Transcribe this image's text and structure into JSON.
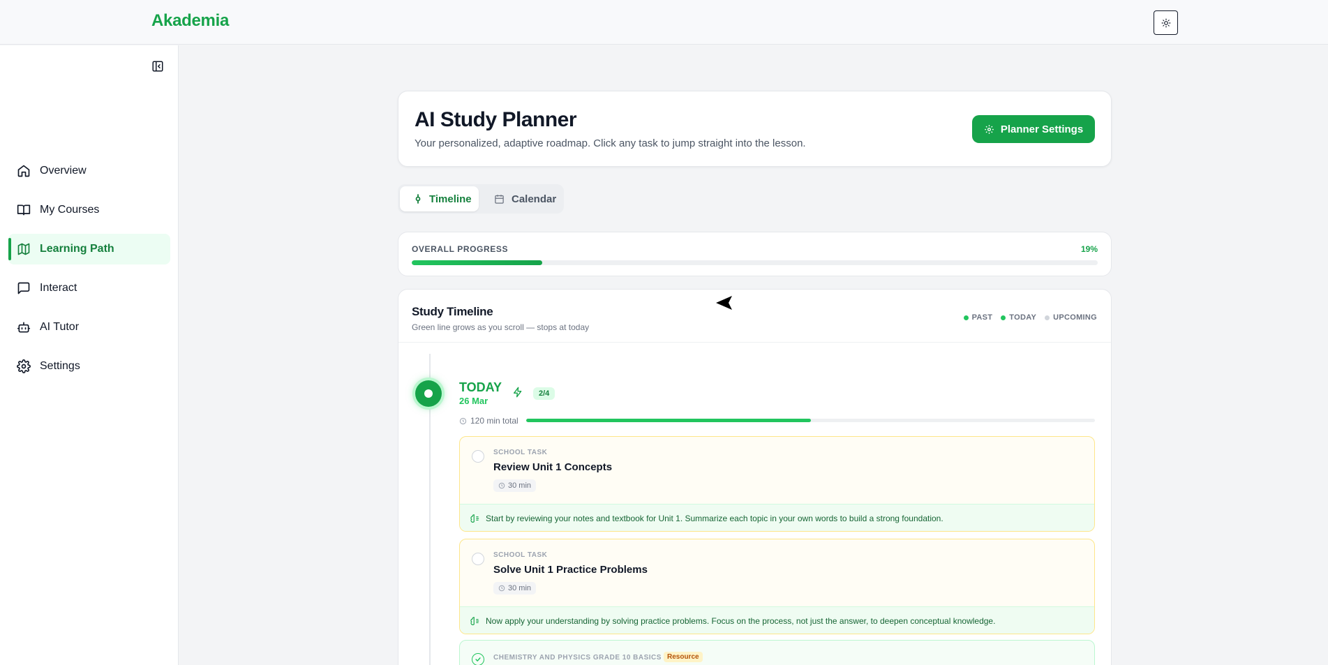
{
  "app": {
    "brand": "Akademia"
  },
  "sidebar": {
    "items": [
      {
        "label": "Overview",
        "icon": "home-icon"
      },
      {
        "label": "My Courses",
        "icon": "book-icon"
      },
      {
        "label": "Learning Path",
        "icon": "map-icon",
        "active": true
      },
      {
        "label": "Interact",
        "icon": "chat-icon"
      },
      {
        "label": "AI Tutor",
        "icon": "bot-icon"
      },
      {
        "label": "Settings",
        "icon": "gear-icon"
      }
    ]
  },
  "header": {
    "title": "AI Study Planner",
    "subtitle": "Your personalized, adaptive roadmap. Click any task to jump straight into the lesson.",
    "settings_button": "Planner Settings"
  },
  "tabs": [
    {
      "label": "Timeline",
      "active": true
    },
    {
      "label": "Calendar",
      "active": false
    }
  ],
  "progress": {
    "label": "OVERALL PROGRESS",
    "percent_text": "19%",
    "value": 0.19
  },
  "timeline": {
    "title": "Study Timeline",
    "subtitle": "Green line grows as you scroll — stops at today",
    "legend": [
      "PAST",
      "TODAY",
      "UPCOMING"
    ],
    "legend_colors": [
      "#22c55e",
      "#22c55e",
      "#d1d5db"
    ],
    "day": {
      "title": "TODAY",
      "date": "26 Mar",
      "count": "2/4",
      "duration": "120 min total",
      "progress": 0.5
    },
    "tasks": [
      {
        "kind": "SCHOOL TASK",
        "name": "Review Unit 1 Concepts",
        "time": "30 min",
        "note": "Start by reviewing your notes and textbook for Unit 1. Summarize each topic in your own words to build a strong foundation."
      },
      {
        "kind": "SCHOOL TASK",
        "name": "Solve Unit 1 Practice Problems",
        "time": "30 min",
        "note": "Now apply your understanding by solving practice problems. Focus on the process, not just the answer, to deepen conceptual knowledge."
      },
      {
        "kind": "CHEMISTRY AND PHYSICS GRADE 10 BASICS",
        "badge": "Resource"
      }
    ]
  },
  "colors": {
    "accent": "#16a34a",
    "accent_light": "#dcfce7",
    "task_border": "#fde68a"
  }
}
